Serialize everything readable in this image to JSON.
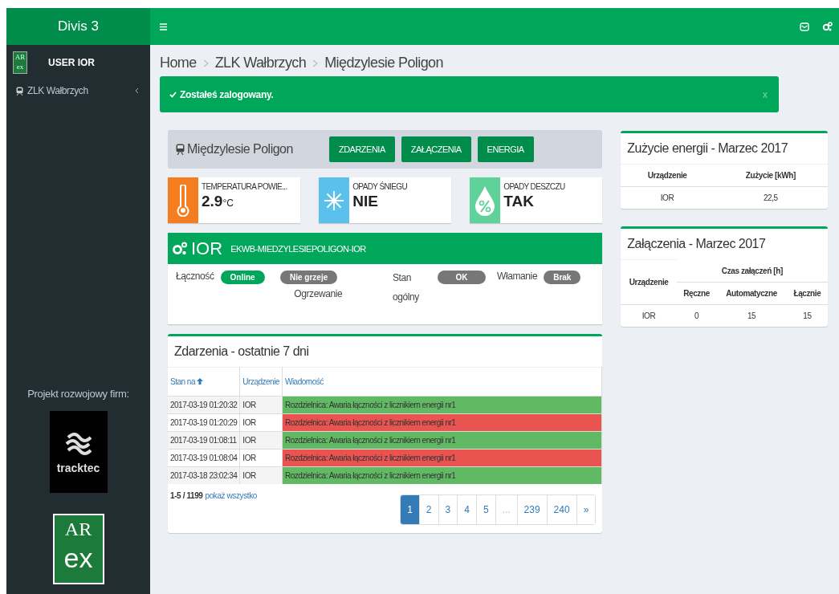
{
  "header": {
    "brand": "Divis 3"
  },
  "sidebar": {
    "user": {
      "logo_top": "AR",
      "logo_bottom": "ex",
      "name": "USER IOR"
    },
    "items": [
      {
        "label": "ZLK Wałbrzych",
        "selected": false
      }
    ],
    "footer_title": "Projekt rozwojowy firm:",
    "logos": [
      {
        "kind": "tracktec",
        "text": "tracktec"
      },
      {
        "kind": "arex",
        "top": "AR",
        "bottom": "ex"
      }
    ]
  },
  "breadcrumb": [
    "Home",
    "ZLK Wałbrzych",
    "Międzylesie Poligon"
  ],
  "alert": {
    "message": "Zostałeś zalogowany.",
    "close": "x"
  },
  "station": {
    "title": "Międzylesie Poligon",
    "buttons": [
      "ZDARZENIA",
      "ZAŁĄCZENIA",
      "ENERGIA"
    ]
  },
  "info_boxes": [
    {
      "kind": "temperature",
      "color": "#f47d20",
      "label": "TEMPERATURA POWIE...",
      "value": "2.9",
      "unit": "°C"
    },
    {
      "kind": "snow",
      "color": "#5bc0eb",
      "label": "OPADY ŚNIEGU",
      "value": "NIE"
    },
    {
      "kind": "rain",
      "color": "#5fd29a",
      "label": "OPADY DESZCZU",
      "value": "TAK"
    }
  ],
  "device": {
    "name": "IOR",
    "code": "EKWB-MIEDZYLESIEPOLIGON-IOR",
    "statuses": [
      {
        "label": "Łączność",
        "value": "Online",
        "color": "#00a65a"
      },
      {
        "label": "Ogrzewanie",
        "value": "Nie grzeje",
        "color": "#777777"
      },
      {
        "label": "Stan ogólny",
        "value": "OK",
        "color": "#777777"
      },
      {
        "label": "Włamanie",
        "value": "Brak",
        "color": "#777777"
      }
    ]
  },
  "events": {
    "title": "Zdarzenia - ostatnie 7 dni",
    "columns": [
      "Stan na",
      "Urządzenie",
      "Wiadomość"
    ],
    "rows": [
      {
        "time": "2017-03-19 01:20:32",
        "device": "IOR",
        "message": "Rozdzielnica: Awaria łączności z licznikiem energii nr1",
        "color": "#62b964"
      },
      {
        "time": "2017-03-19 01:20:29",
        "device": "IOR",
        "message": "Rozdzielnica: Awaria łączności z licznikiem energii nr1",
        "color": "#ea5450"
      },
      {
        "time": "2017-03-19 01:08:11",
        "device": "IOR",
        "message": "Rozdzielnica: Awaria łączności z licznikiem energii nr1",
        "color": "#62b964"
      },
      {
        "time": "2017-03-19 01:08:04",
        "device": "IOR",
        "message": "Rozdzielnica: Awaria łączności z licznikiem energii nr1",
        "color": "#ea5450"
      },
      {
        "time": "2017-03-18 23:02:34",
        "device": "IOR",
        "message": "Rozdzielnica: Awaria łączności z licznikiem energii nr1",
        "color": "#62b964"
      }
    ],
    "summary": "**1-5 / 1199**",
    "show_all": "pokaż wszystko",
    "pages": [
      {
        "label": "1",
        "selected": true,
        "disabled": false
      },
      {
        "label": "2",
        "selected": false,
        "disabled": false
      },
      {
        "label": "3",
        "selected": false,
        "disabled": false
      },
      {
        "label": "4",
        "selected": false,
        "disabled": false
      },
      {
        "label": "5",
        "selected": false,
        "disabled": false
      },
      {
        "label": "...",
        "selected": false,
        "disabled": true
      },
      {
        "label": "239",
        "selected": false,
        "disabled": false
      },
      {
        "label": "240",
        "selected": false,
        "disabled": false
      },
      {
        "label": "»",
        "selected": false,
        "disabled": false
      }
    ]
  },
  "energy": {
    "title": "Zużycie energii - Marzec 2017",
    "columns": [
      "Urządzenie",
      "Zużycie [kWh]"
    ],
    "rows": [
      [
        "IOR",
        "22,5"
      ]
    ]
  },
  "switching": {
    "title": "Załączenia - Marzec 2017",
    "device_column": "Urządzenie",
    "group_column": "Czas załączeń [h]",
    "sub_columns": [
      "Ręczne",
      "Automatyczne",
      "Łącznie"
    ],
    "rows": [
      [
        "IOR",
        "0",
        "15",
        "15"
      ]
    ]
  }
}
